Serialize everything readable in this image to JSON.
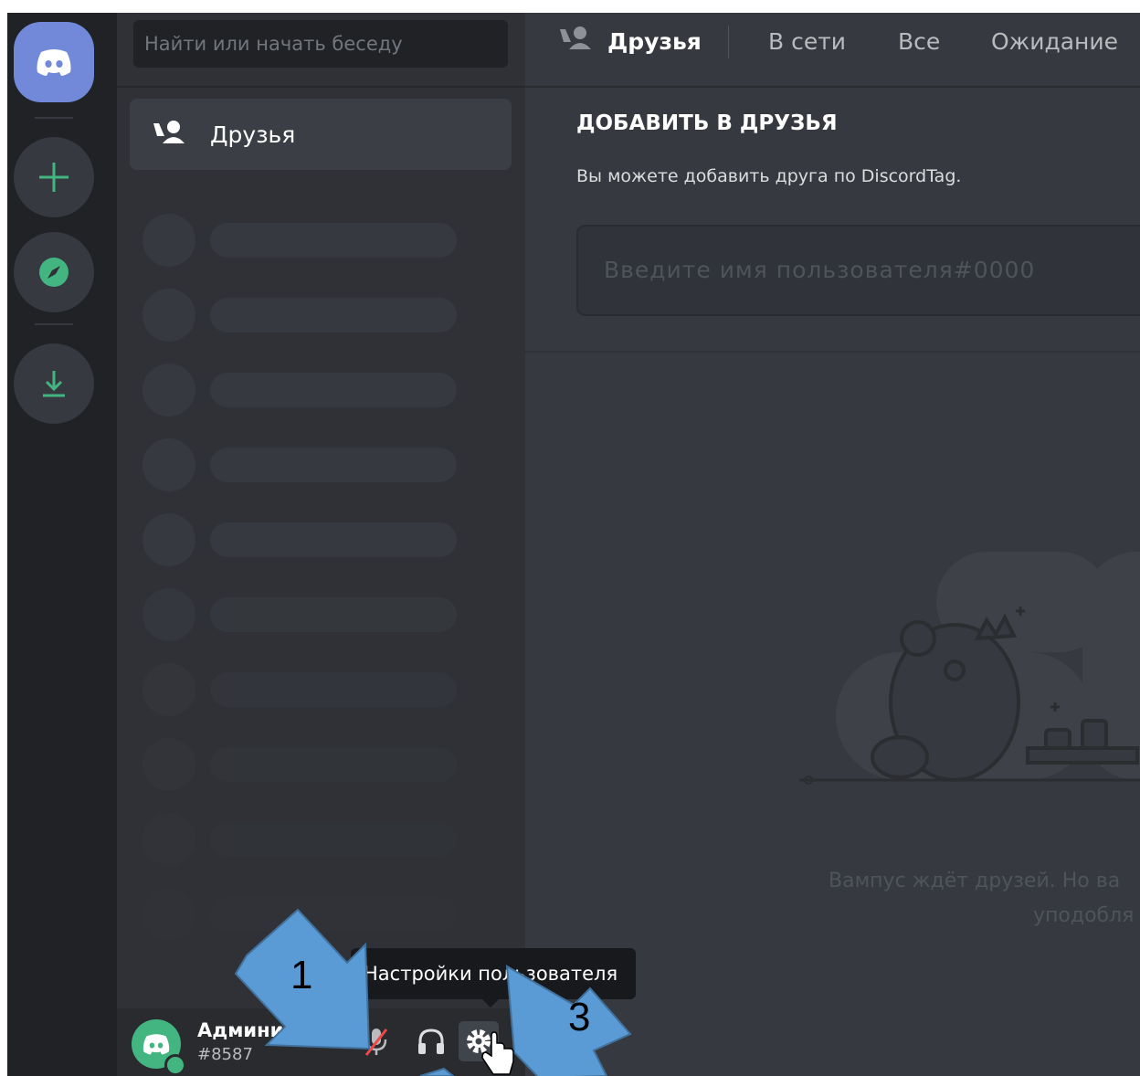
{
  "search": {
    "placeholder": "Найти или начать беседу"
  },
  "sidebar": {
    "friends_label": "Друзья"
  },
  "header": {
    "title": "Друзья",
    "tabs": [
      "В сети",
      "Все",
      "Ожидание"
    ]
  },
  "add_friend": {
    "title": "ДОБАВИТЬ В ДРУЗЬЯ",
    "description": "Вы можете добавить друга по DiscordTag.",
    "placeholder": "Введите имя пользователя#0000"
  },
  "empty_state": {
    "line1": "Вампус ждёт друзей. Но ва",
    "line2": "уподобля"
  },
  "user_panel": {
    "name": "Администр...",
    "tag": "#8587"
  },
  "tooltip": {
    "text": "Настройки пользователя"
  },
  "annotations": {
    "arrow1": "1",
    "arrow3": "3"
  },
  "icons": {
    "home": "discord-logo-icon",
    "add": "plus-icon",
    "explore": "compass-icon",
    "download": "download-icon",
    "friends": "friends-wave-icon",
    "mic": "mic-muted-icon",
    "headphones": "headphones-icon",
    "settings": "gear-icon"
  },
  "colors": {
    "brand": "#7289da",
    "green": "#43b581",
    "background": "#36393f",
    "sidebar": "#2f3136",
    "rail": "#202225",
    "arrow": "#5b9bd5"
  }
}
